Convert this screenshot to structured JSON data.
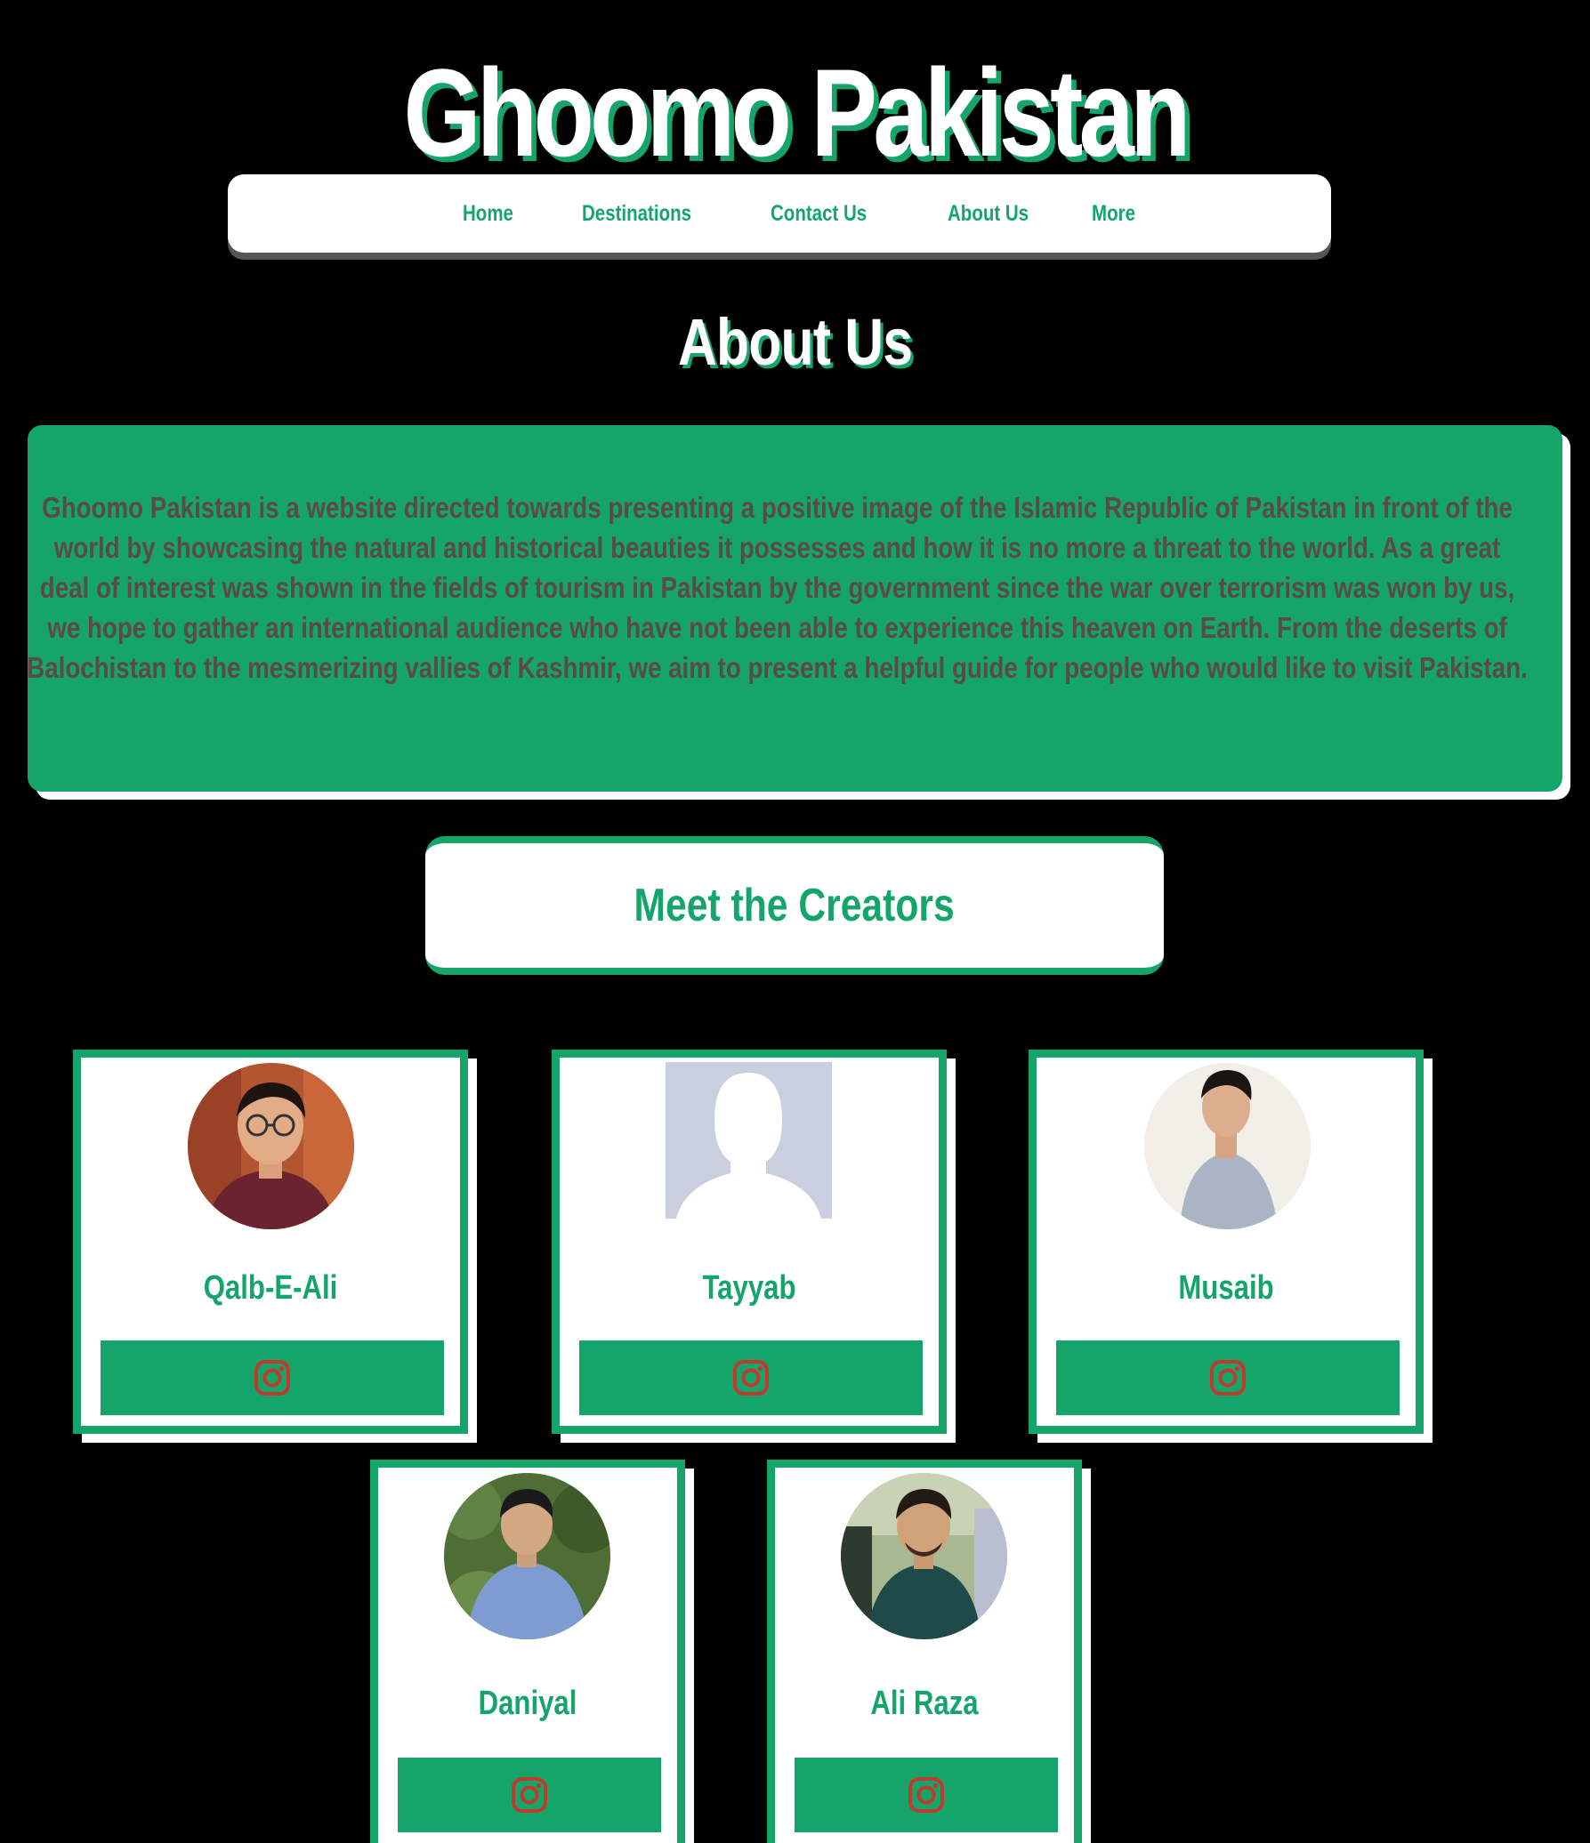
{
  "header": {
    "site_title": "Ghoomo Pakistan"
  },
  "nav": {
    "items": [
      {
        "label": "Home"
      },
      {
        "label": "Destinations"
      },
      {
        "label": "Contact Us"
      },
      {
        "label": "About Us"
      },
      {
        "label": "More"
      }
    ]
  },
  "main": {
    "heading": "About Us",
    "about_text": "Ghoomo Pakistan is a website directed towards presenting a positive image of the Islamic Republic of Pakistan in front of the world by showcasing the natural and historical beauties it possesses and how it is no more a threat to the world. As a great deal of interest was shown in the fields of tourism in Pakistan by the government since the war over terrorism was won by us, we hope to gather an international audience who have not been able to experience this heaven on Earth. From the deserts of Balochistan to the mesmerizing vallies of Kashmir, we aim to present a helpful guide for people who would like to visit Pakistan.",
    "creators_heading": "Meet the Creators"
  },
  "creators": [
    {
      "name": "Qalb-E-Ali",
      "photo": "portrait-photo",
      "social_icon": "instagram-icon"
    },
    {
      "name": "Tayyab",
      "photo": "default-avatar-placeholder",
      "social_icon": "instagram-icon"
    },
    {
      "name": "Musaib",
      "photo": "portrait-photo",
      "social_icon": "instagram-icon"
    },
    {
      "name": "Daniyal",
      "photo": "portrait-photo",
      "social_icon": "instagram-icon"
    },
    {
      "name": "Ali Raza",
      "photo": "portrait-photo",
      "social_icon": "instagram-icon"
    }
  ],
  "colors": {
    "background": "#000000",
    "accent_green": "#15a56a",
    "card_white": "#ffffff",
    "body_text": "#5a4a48",
    "icon_red": "#c0392b"
  }
}
